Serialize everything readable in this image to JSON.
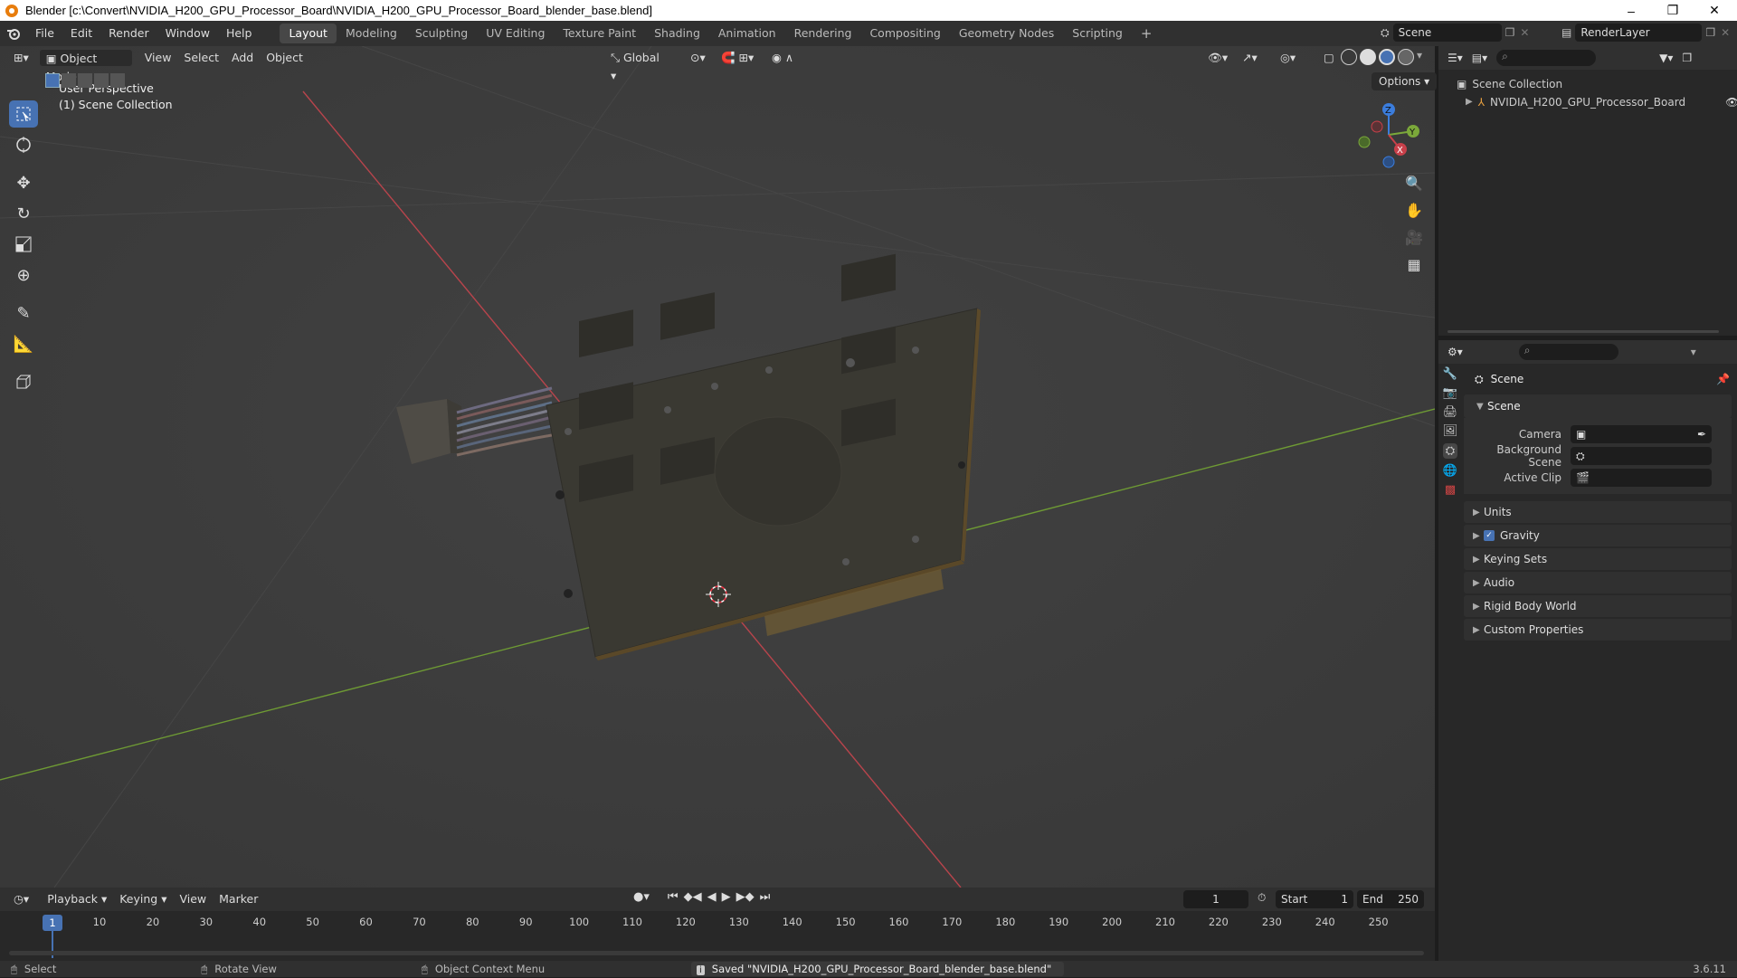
{
  "window": {
    "title": "Blender [c:\\Convert\\NVIDIA_H200_GPU_Processor_Board\\NVIDIA_H200_GPU_Processor_Board_blender_base.blend]",
    "minimize": "–",
    "maximize": "❐",
    "close": "✕"
  },
  "menu": {
    "items": [
      "File",
      "Edit",
      "Render",
      "Window",
      "Help"
    ]
  },
  "workspaces": [
    "Layout",
    "Modeling",
    "Sculpting",
    "UV Editing",
    "Texture Paint",
    "Shading",
    "Animation",
    "Rendering",
    "Compositing",
    "Geometry Nodes",
    "Scripting"
  ],
  "workspace_add": "+",
  "scene_selector": {
    "value": "Scene"
  },
  "renderlayer_selector": {
    "value": "RenderLayer"
  },
  "viewport_header": {
    "mode": "Object Mode",
    "menus": [
      "View",
      "Select",
      "Add",
      "Object"
    ],
    "orientation": "Global",
    "options": "Options"
  },
  "viewport": {
    "overlay_line1": "User Perspective",
    "overlay_line2": "(1) Scene Collection",
    "gizmo": {
      "z": "Z",
      "y": "Y",
      "x": "X"
    }
  },
  "outliner": {
    "root": "Scene Collection",
    "object": "NVIDIA_H200_GPU_Processor_Board"
  },
  "properties": {
    "header": "Scene",
    "section": "Scene",
    "fields": [
      {
        "label": "Camera",
        "value": ""
      },
      {
        "label": "Background Scene",
        "value": ""
      },
      {
        "label": "Active Clip",
        "value": ""
      }
    ],
    "panels": [
      "Units",
      "Gravity",
      "Keying Sets",
      "Audio",
      "Rigid Body World",
      "Custom Properties"
    ],
    "gravity_checked": true
  },
  "timeline": {
    "menus": [
      "Playback",
      "Keying",
      "View",
      "Marker"
    ],
    "current_frame": "1",
    "start_label": "Start",
    "start_value": "1",
    "end_label": "End",
    "end_value": "250",
    "ticks": [
      "1",
      "10",
      "20",
      "30",
      "40",
      "50",
      "60",
      "70",
      "80",
      "90",
      "100",
      "110",
      "120",
      "130",
      "140",
      "150",
      "160",
      "170",
      "180",
      "190",
      "200",
      "210",
      "220",
      "230",
      "240",
      "250"
    ]
  },
  "statusbar": {
    "select": "Select",
    "rotate": "Rotate View",
    "context": "Object Context Menu",
    "message": "Saved \"NVIDIA_H200_GPU_Processor_Board_blender_base.blend\"",
    "version": "3.6.11"
  },
  "colors": {
    "accent": "#4772b3",
    "x_axis": "#c8404a",
    "y_axis": "#7ba83a",
    "z_axis": "#3b7ddd",
    "playhead": "#4772b3"
  }
}
